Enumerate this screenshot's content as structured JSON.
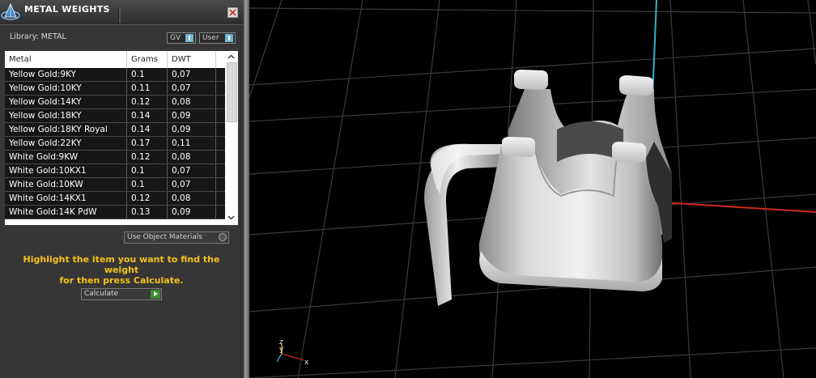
{
  "panel": {
    "title": "METAL WEIGHTS",
    "library_label": "Library: METAL",
    "toggles": {
      "gv_label": "GV",
      "user_label": "User"
    },
    "table": {
      "columns": [
        "Metal",
        "Grams",
        "DWT"
      ],
      "rows": [
        {
          "metal": "Yellow Gold:9KY",
          "grams": "0.1",
          "dwt": "0,07"
        },
        {
          "metal": "Yellow Gold:10KY",
          "grams": "0.11",
          "dwt": "0,07"
        },
        {
          "metal": "Yellow Gold:14KY",
          "grams": "0.12",
          "dwt": "0,08"
        },
        {
          "metal": "Yellow Gold:18KY",
          "grams": "0.14",
          "dwt": "0,09"
        },
        {
          "metal": "Yellow Gold:18KY Royal",
          "grams": "0.14",
          "dwt": "0,09"
        },
        {
          "metal": "Yellow Gold:22KY",
          "grams": "0.17",
          "dwt": "0,11"
        },
        {
          "metal": "White Gold:9KW",
          "grams": "0.12",
          "dwt": "0,08"
        },
        {
          "metal": "White Gold:10KX1",
          "grams": "0.1",
          "dwt": "0,07"
        },
        {
          "metal": "White Gold:10KW",
          "grams": "0.1",
          "dwt": "0,07"
        },
        {
          "metal": "White Gold:14KX1",
          "grams": "0.12",
          "dwt": "0,08"
        },
        {
          "metal": "White Gold:14K PdW",
          "grams": "0.13",
          "dwt": "0,09"
        }
      ]
    },
    "use_object_materials_label": "Use Object Materials",
    "instructions": [
      "Highlight the item you want to find the weight",
      "for then press Calculate."
    ],
    "calculate_label": "Calculate"
  },
  "viewport": {
    "axis_labels": {
      "z": "z",
      "y": "y",
      "x": "x"
    },
    "colors": {
      "background": "#000000",
      "grid": "#3a3a3a",
      "x_axis": "#cc2a1e",
      "z_axis": "#2fb4c7",
      "model": "#d9d9d9",
      "accent": "#f6c21a"
    }
  }
}
